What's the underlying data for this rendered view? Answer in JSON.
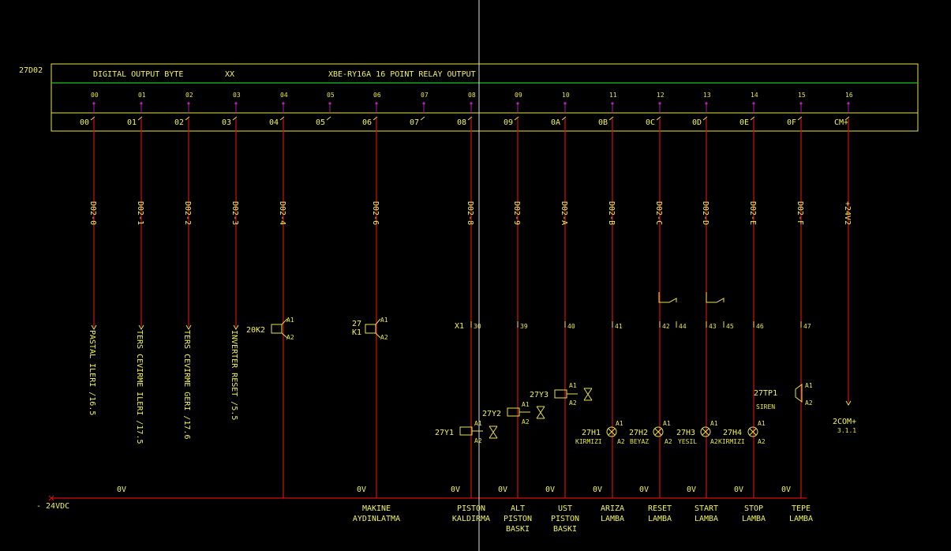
{
  "module": {
    "tag": "27D02",
    "title_left": "DIGITAL OUTPUT BYTE",
    "title_xx": "XX",
    "title_right": "XBE-RY16A 16 POINT RELAY OUTPUT",
    "pins": [
      "00",
      "01",
      "02",
      "03",
      "04",
      "05",
      "06",
      "07",
      "08",
      "09",
      "10",
      "11",
      "12",
      "13",
      "14",
      "15",
      "16"
    ],
    "terminals": [
      "00",
      "01",
      "02",
      "03",
      "04",
      "05",
      "06",
      "07",
      "08",
      "09",
      "0A",
      "0B",
      "0C",
      "0D",
      "0E",
      "0F",
      "CM+"
    ]
  },
  "wires": {
    "labels": [
      "D02-0",
      "D02-1",
      "D02-2",
      "D02-3",
      "D02-4",
      "D02-6",
      "D02-8",
      "D02-9",
      "D02-A",
      "D02-B",
      "D02-C",
      "D02-D",
      "D02-E",
      "D02-F",
      "+24V2"
    ]
  },
  "refs": {
    "r0": "PASTAL ILERI /16.5",
    "r1": "TERS CEVIRME ILERI /17.5",
    "r2": "TERS CEVIRME GERI /17.6",
    "r3": "INVERTER RESET /5.5"
  },
  "devices": {
    "k2": "20K2",
    "k1_top": "27",
    "k1_bot": "K1",
    "a1": "A1",
    "a2": "A2",
    "x1": "X1",
    "terms": [
      "30",
      "39",
      "40",
      "41",
      "42",
      "44",
      "43",
      "45",
      "46",
      "47"
    ],
    "y1": "27Y1",
    "y2": "27Y2",
    "y3": "27Y3",
    "h1": "27H1",
    "h1c": "KIRMIZI",
    "h2": "27H2",
    "h2c": "BEYAZ",
    "h3": "27H3",
    "h3c": "YESIL",
    "h4": "27H4",
    "h4c": "KIRMIZI",
    "tp1": "27TP1",
    "tp1c": "SIREN",
    "com": "2COM+",
    "com_ref": "3.1.1"
  },
  "bottom": {
    "supply": "- 24VDC",
    "ov": "0V",
    "names": [
      [
        "MAKINE",
        "AYDINLATMA"
      ],
      [
        "PISTON",
        "KALDIRMA"
      ],
      [
        "ALT",
        "PISTON",
        "BASKI"
      ],
      [
        "UST",
        "PISTON",
        "BASKI"
      ],
      [
        "ARIZA",
        "LAMBA"
      ],
      [
        "RESET",
        "LAMBA"
      ],
      [
        "START",
        "LAMBA"
      ],
      [
        "STOP",
        "LAMBA"
      ],
      [
        "TEPE",
        "LAMBA"
      ]
    ]
  }
}
